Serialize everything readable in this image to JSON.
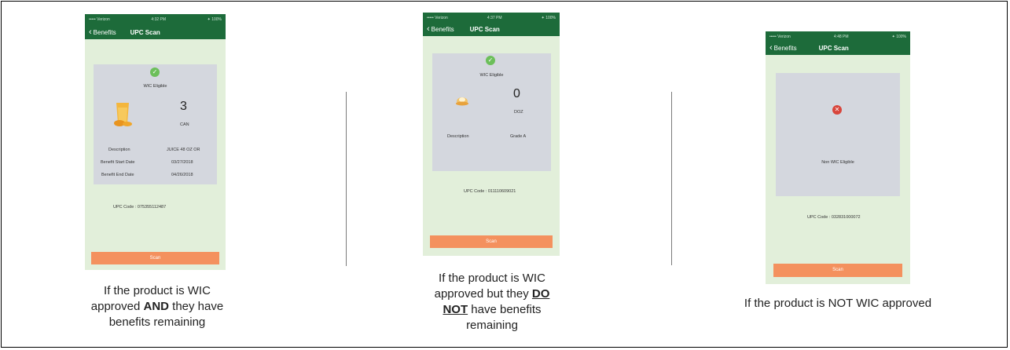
{
  "panels": [
    {
      "nav": {
        "back_label": "Benefits",
        "title": "UPC Scan"
      },
      "status": {
        "carrier": "••••• Verizon",
        "time": "4:32 PM",
        "battery": "✦ 100%"
      },
      "eligibility": "WIC Eligible",
      "quantity": "3",
      "unit": "CAN",
      "details": [
        {
          "label": "Description",
          "value": "JUICE 48 OZ OR"
        },
        {
          "label": "Benefit Start Date",
          "value": "03/27/2018"
        },
        {
          "label": "Benefit End Date",
          "value": "04/26/2018"
        }
      ],
      "upc": "UPC Code : 075355112487",
      "scan_label": "Scan",
      "caption_parts": [
        "If the product is WIC approved ",
        "AND",
        " they have benefits remaining"
      ]
    },
    {
      "nav": {
        "back_label": "Benefits",
        "title": "UPC Scan"
      },
      "status": {
        "carrier": "••••• Verizon",
        "time": "4:37 PM",
        "battery": "✦ 100%"
      },
      "eligibility": "WIC Eligible",
      "quantity": "0",
      "unit": "DOZ",
      "details": [
        {
          "label": "Description",
          "value": "Grade A"
        }
      ],
      "upc": "UPC Code : 011110609021",
      "scan_label": "Scan",
      "caption_parts": [
        "If the product is WIC approved but they ",
        "DO NOT",
        " have benefits remaining"
      ]
    },
    {
      "nav": {
        "back_label": "Benefits",
        "title": "UPC Scan"
      },
      "status": {
        "carrier": "••••• Verizon",
        "time": "4:48 PM",
        "battery": "✦ 100%"
      },
      "eligibility": "Non WIC Eligible",
      "upc": "UPC Code : 032831000072",
      "scan_label": "Scan",
      "caption": "If the product is NOT WIC approved"
    }
  ],
  "icons": {
    "check": "check-circle-icon",
    "error": "x-circle-icon",
    "juice": "juice-product-icon",
    "egg": "egg-product-icon",
    "back": "chevron-left-icon"
  },
  "colors": {
    "nav_green": "#1d6b3a",
    "screen_bg": "#e2efda",
    "card_bg": "#d4d7de",
    "scan_orange": "#f4915e",
    "eligible_green": "#6cbf5a",
    "error_red": "#d8453b"
  }
}
